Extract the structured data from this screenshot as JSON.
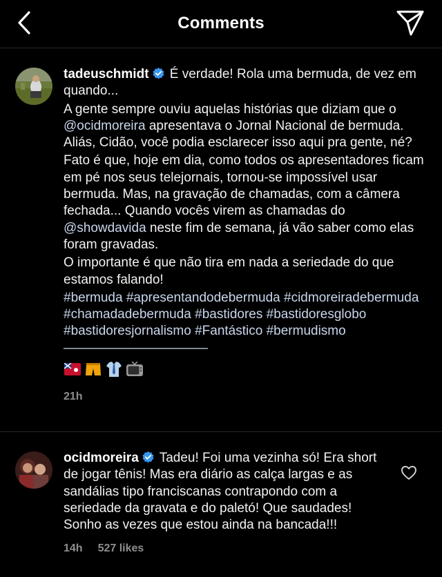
{
  "header": {
    "title": "Comments"
  },
  "comment1": {
    "username": "tadeuschmidt",
    "line1": " É verdade! Rola uma bermuda, de vez em quando...",
    "para2_a": "A gente sempre ouviu aquelas histórias que diziam que o ",
    "para2_mention": "@ocidmoreira",
    "para2_b": " apresentava o Jornal Nacional de bermuda. Aliás, Cidão, você podia esclarecer isso aqui pra gente, né?",
    "para3_a": "Fato é que, hoje em dia, como todos os apresentadores ficam em pé nos seus telejornais, tornou-se impossível usar bermuda. Mas, na gravação de chamadas, com a câmera fechada... Quando vocês virem as chamadas do ",
    "para3_mention": "@showdavida",
    "para3_b": " neste fim de semana, já vão saber como elas foram gravadas.",
    "para4": "O importante é que não tira em nada a seriedade do que estamos falando!",
    "hashtags": "#bermuda #apresentandodebermuda #cidmoreiradebermuda #chamadadebermuda #bastidores #bastidoresglobo #bastidoresjornalismo #Fantástico #bermudismo ———————————",
    "emojis": [
      "flag-bermuda-icon",
      "shorts-icon",
      "shirt-tie-icon",
      "television-icon"
    ],
    "time": "21h"
  },
  "comment2": {
    "username": "ocidmoreira",
    "text": " Tadeu! Foi uma vezinha só! Era short de jogar tênis! Mas era diário as calça largas e as sandálias tipo franciscanas contrapondo com a seriedade da gravata e do paletó! Que saudades! Sonho as vezes que estou ainda na bancada!!!",
    "time": "14h",
    "likes": "527 likes"
  },
  "colors": {
    "background": "#000000",
    "text": "#f5f5f5",
    "meta": "#8e8e8e",
    "verified": "#3897f0",
    "divider": "#262626"
  }
}
